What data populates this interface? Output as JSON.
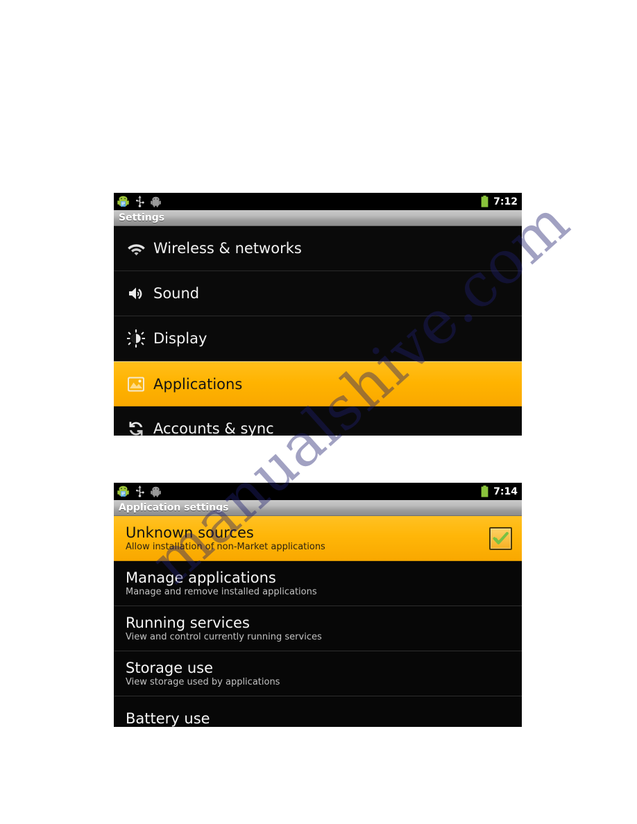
{
  "page": {
    "watermark": "manualshive.com",
    "background": "#ffffff"
  },
  "colors": {
    "accent_selected": "#ffb300",
    "list_background": "#000000",
    "titlebar_text": "#ffffff",
    "battery_green": "#8ac33c",
    "check_green": "#7ac143"
  },
  "screenshot_settings": {
    "statusbar": {
      "icons": [
        "android-notification-icon",
        "usb-icon",
        "android-debug-icon"
      ],
      "battery_icon": "battery-full-icon",
      "time": "7:12"
    },
    "titlebar": {
      "title": "Settings"
    },
    "rows": [
      {
        "icon": "wifi-icon",
        "label": "Wireless & networks",
        "selected": false
      },
      {
        "icon": "speaker-icon",
        "label": "Sound",
        "selected": false
      },
      {
        "icon": "brightness-icon",
        "label": "Display",
        "selected": false
      },
      {
        "icon": "applications-icon",
        "label": "Applications",
        "selected": true
      },
      {
        "icon": "sync-icon",
        "label": "Accounts & sync",
        "selected": false
      }
    ]
  },
  "screenshot_application_settings": {
    "statusbar": {
      "icons": [
        "android-notification-icon",
        "usb-icon",
        "android-debug-icon"
      ],
      "battery_icon": "battery-full-icon",
      "time": "7:14"
    },
    "titlebar": {
      "title": "Application settings"
    },
    "rows": [
      {
        "title": "Unknown sources",
        "summary": "Allow installation of non-Market applications",
        "selected": true,
        "has_checkbox": true,
        "checked": true
      },
      {
        "title": "Manage applications",
        "summary": "Manage and remove installed applications",
        "selected": false,
        "has_checkbox": false
      },
      {
        "title": "Running services",
        "summary": "View and control currently running services",
        "selected": false,
        "has_checkbox": false
      },
      {
        "title": "Storage use",
        "summary": "View storage used by applications",
        "selected": false,
        "has_checkbox": false
      },
      {
        "title": "Battery use",
        "summary": "",
        "selected": false,
        "has_checkbox": false
      }
    ]
  }
}
